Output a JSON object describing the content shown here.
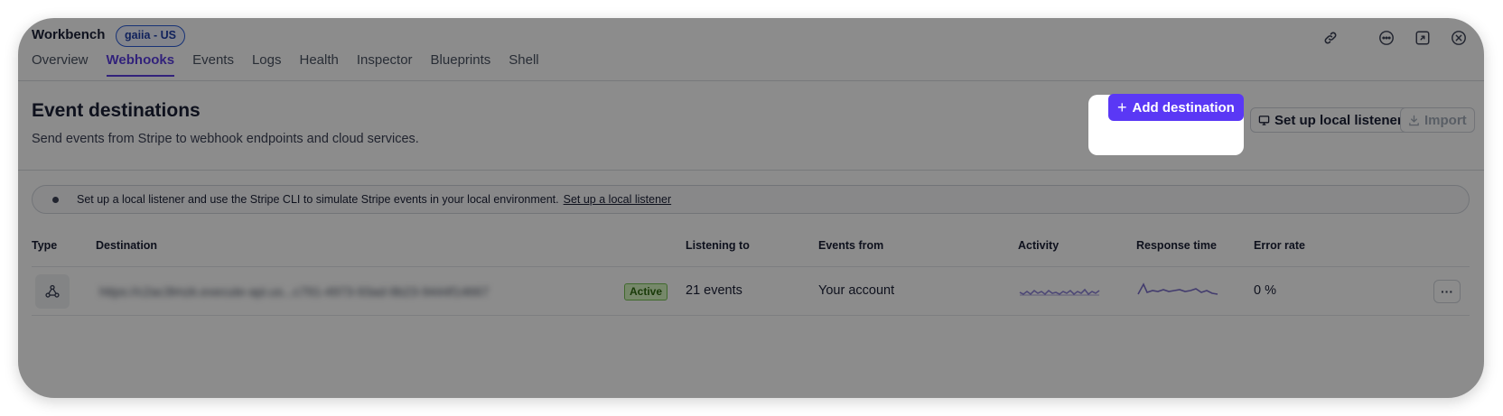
{
  "app": {
    "title": "Workbench",
    "env_badge": "gaiia - US"
  },
  "tabs": [
    {
      "label": "Overview",
      "active": false
    },
    {
      "label": "Webhooks",
      "active": true
    },
    {
      "label": "Events",
      "active": false
    },
    {
      "label": "Logs",
      "active": false
    },
    {
      "label": "Health",
      "active": false
    },
    {
      "label": "Inspector",
      "active": false
    },
    {
      "label": "Blueprints",
      "active": false
    },
    {
      "label": "Shell",
      "active": false
    }
  ],
  "window_icons": [
    "link-icon",
    "dots-icon",
    "expand-icon",
    "close-icon"
  ],
  "header": {
    "title": "Event destinations",
    "subtitle": "Send events from Stripe to webhook endpoints and cloud services.",
    "add_label": "Add destination",
    "listener_label": "Set up local listener",
    "import_label": "Import"
  },
  "banner": {
    "text": "Set up a local listener and use the Stripe CLI to simulate Stripe events in your local environment.",
    "link": "Set up a local listener"
  },
  "table": {
    "columns": [
      "Type",
      "Destination",
      "Listening to",
      "Events from",
      "Activity",
      "Response time",
      "Error rate"
    ],
    "rows": [
      {
        "type_icon": "webhook-icon",
        "destination": "https://c2ac3lmzk.execute-api.us...c791-4973-93ad-9b23-9444f14667",
        "status": "Active",
        "listening_to": "21 events",
        "events_from": "Your account",
        "error_rate": "0 %"
      }
    ]
  },
  "colors": {
    "accent": "#5a38f5",
    "active_tab": "#5b3fe0",
    "status_green": "#d7f7c2"
  }
}
